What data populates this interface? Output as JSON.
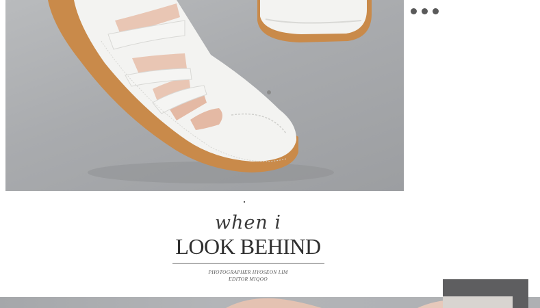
{
  "main_image": {
    "subject": "white leather sandal",
    "alt": ""
  },
  "more_menu": {
    "icon": "more-dots-icon"
  },
  "caption": {
    "script_title": "when i",
    "title": "LOOK BEHIND",
    "credit_line1": "PHOTOGRAPHER HYOSEON LIM",
    "credit_line2": "EDITOR MIQOO"
  },
  "colors": {
    "photo_background": "#a9abae",
    "sole": "#c98a4a",
    "leather": "#f3f3f1",
    "text": "#3a3a3a",
    "panel": "#5e5e60"
  }
}
